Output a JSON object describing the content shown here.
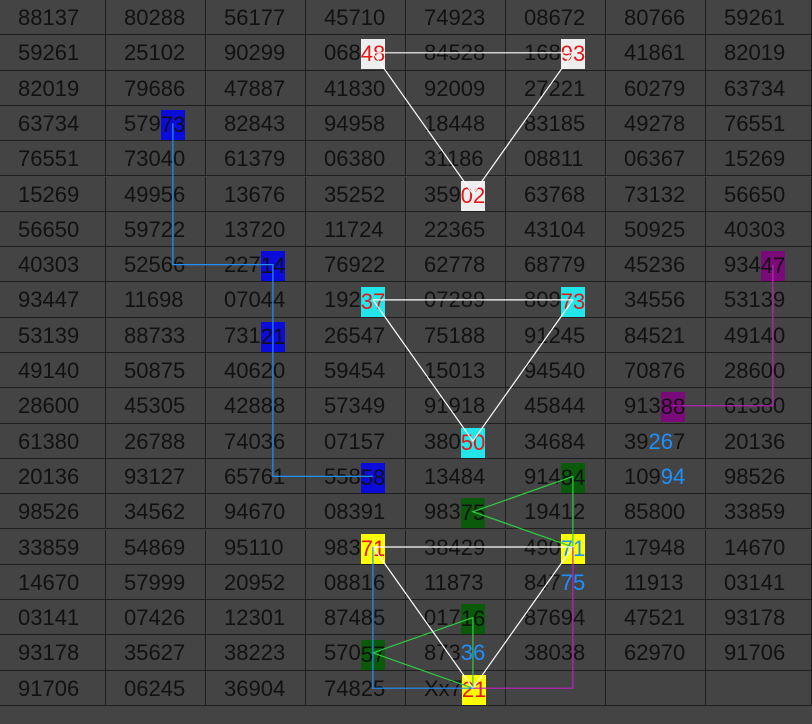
{
  "rows": [
    [
      "88137",
      "80288",
      "56177",
      "45710",
      "74923",
      "08672",
      "80766",
      "59261"
    ],
    [
      "59261",
      "25102",
      "90299",
      "06848",
      "84528",
      "16893",
      "41861",
      "82019"
    ],
    [
      "82019",
      "79686",
      "47887",
      "41830",
      "92009",
      "27221",
      "60279",
      "63734"
    ],
    [
      "63734",
      "57973",
      "82843",
      "94958",
      "18448",
      "83185",
      "49278",
      "76551"
    ],
    [
      "76551",
      "73040",
      "61379",
      "06380",
      "31186",
      "08811",
      "06367",
      "15269"
    ],
    [
      "15269",
      "49956",
      "13676",
      "35252",
      "35902",
      "63768",
      "73132",
      "56650"
    ],
    [
      "56650",
      "59722",
      "13720",
      "11724",
      "22365",
      "43104",
      "50925",
      "40303"
    ],
    [
      "40303",
      "52566",
      "22714",
      "76922",
      "62778",
      "68779",
      "45236",
      "93447"
    ],
    [
      "93447",
      "11698",
      "07044",
      "19237",
      "07289",
      "80973",
      "34556",
      "53139"
    ],
    [
      "53139",
      "88733",
      "73121",
      "26547",
      "75188",
      "91245",
      "84521",
      "49140"
    ],
    [
      "49140",
      "50875",
      "40620",
      "59454",
      "15013",
      "94540",
      "70876",
      "28600"
    ],
    [
      "28600",
      "45305",
      "42888",
      "57349",
      "91918",
      "45844",
      "91388",
      "61380"
    ],
    [
      "61380",
      "26788",
      "74036",
      "07157",
      "38050",
      "34684",
      "39267",
      "20136"
    ],
    [
      "20136",
      "93127",
      "65761",
      "55858",
      "13484",
      "91484",
      "10994",
      "98526"
    ],
    [
      "98526",
      "34562",
      "94670",
      "08391",
      "98375",
      "19412",
      "85800",
      "33859"
    ],
    [
      "33859",
      "54869",
      "95110",
      "98371",
      "38429",
      "49071",
      "17948",
      "14670"
    ],
    [
      "14670",
      "57999",
      "20952",
      "08816",
      "11873",
      "84775",
      "11913",
      "03141"
    ],
    [
      "03141",
      "07426",
      "12301",
      "87485",
      "01716",
      "87694",
      "47521",
      "93178"
    ],
    [
      "93178",
      "35627",
      "38223",
      "57057",
      "87336",
      "38038",
      "62970",
      "91706"
    ],
    [
      "91706",
      "06245",
      "36904",
      "74825",
      "Xx721",
      "",
      "",
      ""
    ]
  ],
  "highlights": [
    {
      "r": 1,
      "c": 3,
      "text": "48",
      "bg": "#eeeeee",
      "fg": "#e21818"
    },
    {
      "r": 1,
      "c": 5,
      "text": "93",
      "bg": "#eeeeee",
      "fg": "#e21818"
    },
    {
      "r": 5,
      "c": 4,
      "text": "02",
      "bg": "#eeeeee",
      "fg": "#e21818"
    },
    {
      "r": 3,
      "c": 1,
      "text": "73",
      "bg": "#0b0bdc",
      "fg": "#111111"
    },
    {
      "r": 7,
      "c": 2,
      "text": "14",
      "bg": "#0b0bdc",
      "fg": "#111111"
    },
    {
      "r": 9,
      "c": 2,
      "text": "21",
      "bg": "#0b0bdc",
      "fg": "#111111"
    },
    {
      "r": 13,
      "c": 3,
      "text": "58",
      "bg": "#0b0bdc",
      "fg": "#111111"
    },
    {
      "r": 7,
      "c": 7,
      "text": "47",
      "bg": "#7a0a7a",
      "fg": "#111111"
    },
    {
      "r": 11,
      "c": 6,
      "text": "88",
      "bg": "#7a0a7a",
      "fg": "#111111"
    },
    {
      "r": 8,
      "c": 3,
      "text": "37",
      "bg": "#22e6ea",
      "fg": "#e21818"
    },
    {
      "r": 8,
      "c": 5,
      "text": "73",
      "bg": "#22e6ea",
      "fg": "#e21818"
    },
    {
      "r": 12,
      "c": 4,
      "text": "50",
      "bg": "#22e6ea",
      "fg": "#e21818"
    },
    {
      "r": 13,
      "c": 5,
      "text": "84",
      "bg": "#0b5a0b",
      "fg": "#111111"
    },
    {
      "r": 14,
      "c": 4,
      "text": "75",
      "bg": "#0b5a0b",
      "fg": "#111111"
    },
    {
      "r": 17,
      "c": 4,
      "text": "16",
      "bg": "#0b5a0b",
      "fg": "#111111"
    },
    {
      "r": 18,
      "c": 3,
      "text": "57",
      "bg": "#0b5a0b",
      "fg": "#111111"
    },
    {
      "r": 15,
      "c": 3,
      "text": "71",
      "bg": "#ffff00",
      "fg": "#e21818"
    },
    {
      "r": 15,
      "c": 5,
      "text": "71",
      "bg": "#ffff00",
      "fg": "#1e90ff",
      "split": "0"
    },
    {
      "r": 19,
      "c": 4,
      "text": "21",
      "bg": "#ffff00",
      "fg": "#e21818",
      "split": "7"
    }
  ],
  "blueDigits": [
    {
      "r": 12,
      "c": 6,
      "text": "26"
    },
    {
      "r": 13,
      "c": 6,
      "text": "94"
    },
    {
      "r": 16,
      "c": 5,
      "text": "75"
    },
    {
      "r": 18,
      "c": 4,
      "text": "36"
    }
  ],
  "paths": [
    {
      "color": "#ffffff",
      "pts": [
        [
          1,
          3
        ],
        [
          5,
          4
        ],
        [
          1,
          5
        ]
      ],
      "close": false
    },
    {
      "color": "#ffffff",
      "pts": [
        [
          1,
          3
        ],
        [
          1,
          5
        ]
      ]
    },
    {
      "color": "#1e90ff",
      "pts": [
        [
          3,
          1
        ],
        [
          7,
          1
        ],
        [
          7,
          2
        ],
        [
          9,
          2
        ],
        [
          13,
          2
        ],
        [
          13,
          3
        ]
      ]
    },
    {
      "color": "#c020c0",
      "pts": [
        [
          7,
          7
        ],
        [
          11,
          7
        ],
        [
          11,
          6
        ]
      ]
    },
    {
      "color": "#ffffff",
      "pts": [
        [
          8,
          3
        ],
        [
          12,
          4
        ],
        [
          8,
          5
        ]
      ]
    },
    {
      "color": "#ffffff",
      "pts": [
        [
          8,
          3
        ],
        [
          8,
          5
        ]
      ]
    },
    {
      "color": "#2ecc40",
      "pts": [
        [
          13,
          5
        ],
        [
          14,
          4
        ],
        [
          15,
          5
        ],
        [
          13,
          5
        ]
      ]
    },
    {
      "color": "#2ecc40",
      "pts": [
        [
          17,
          4
        ],
        [
          18,
          3
        ],
        [
          19,
          4
        ]
      ]
    },
    {
      "color": "#2ecc40",
      "pts": [
        [
          17,
          4
        ],
        [
          19,
          4
        ]
      ]
    },
    {
      "color": "#ffffff",
      "pts": [
        [
          15,
          3
        ],
        [
          19,
          4
        ],
        [
          15,
          5
        ],
        [
          15,
          3
        ]
      ]
    },
    {
      "color": "#1e90ff",
      "pts": [
        [
          15,
          3
        ],
        [
          19,
          3
        ],
        [
          19,
          4
        ]
      ]
    },
    {
      "color": "#c020c0",
      "pts": [
        [
          15,
          5
        ],
        [
          19,
          5
        ],
        [
          19,
          4
        ]
      ]
    }
  ]
}
